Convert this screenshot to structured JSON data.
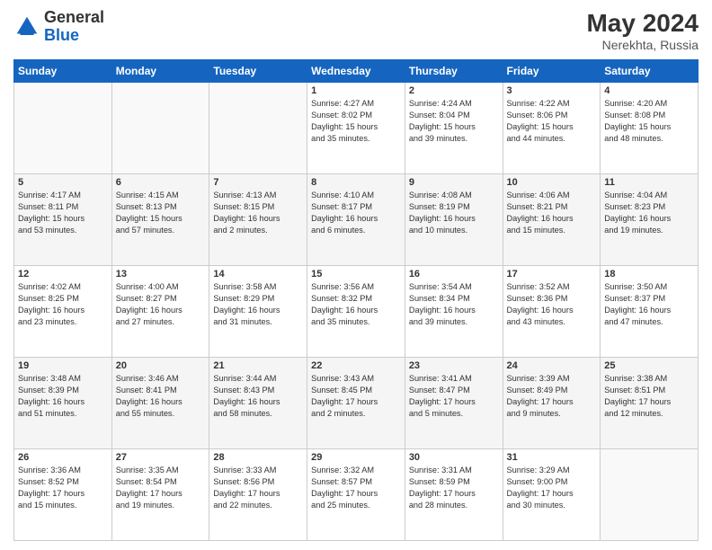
{
  "header": {
    "monthYear": "May 2024",
    "location": "Nerekhta, Russia"
  },
  "days": [
    "Sunday",
    "Monday",
    "Tuesday",
    "Wednesday",
    "Thursday",
    "Friday",
    "Saturday"
  ],
  "weeks": [
    [
      {
        "day": "",
        "info": ""
      },
      {
        "day": "",
        "info": ""
      },
      {
        "day": "",
        "info": ""
      },
      {
        "day": "1",
        "info": "Sunrise: 4:27 AM\nSunset: 8:02 PM\nDaylight: 15 hours\nand 35 minutes."
      },
      {
        "day": "2",
        "info": "Sunrise: 4:24 AM\nSunset: 8:04 PM\nDaylight: 15 hours\nand 39 minutes."
      },
      {
        "day": "3",
        "info": "Sunrise: 4:22 AM\nSunset: 8:06 PM\nDaylight: 15 hours\nand 44 minutes."
      },
      {
        "day": "4",
        "info": "Sunrise: 4:20 AM\nSunset: 8:08 PM\nDaylight: 15 hours\nand 48 minutes."
      }
    ],
    [
      {
        "day": "5",
        "info": "Sunrise: 4:17 AM\nSunset: 8:11 PM\nDaylight: 15 hours\nand 53 minutes."
      },
      {
        "day": "6",
        "info": "Sunrise: 4:15 AM\nSunset: 8:13 PM\nDaylight: 15 hours\nand 57 minutes."
      },
      {
        "day": "7",
        "info": "Sunrise: 4:13 AM\nSunset: 8:15 PM\nDaylight: 16 hours\nand 2 minutes."
      },
      {
        "day": "8",
        "info": "Sunrise: 4:10 AM\nSunset: 8:17 PM\nDaylight: 16 hours\nand 6 minutes."
      },
      {
        "day": "9",
        "info": "Sunrise: 4:08 AM\nSunset: 8:19 PM\nDaylight: 16 hours\nand 10 minutes."
      },
      {
        "day": "10",
        "info": "Sunrise: 4:06 AM\nSunset: 8:21 PM\nDaylight: 16 hours\nand 15 minutes."
      },
      {
        "day": "11",
        "info": "Sunrise: 4:04 AM\nSunset: 8:23 PM\nDaylight: 16 hours\nand 19 minutes."
      }
    ],
    [
      {
        "day": "12",
        "info": "Sunrise: 4:02 AM\nSunset: 8:25 PM\nDaylight: 16 hours\nand 23 minutes."
      },
      {
        "day": "13",
        "info": "Sunrise: 4:00 AM\nSunset: 8:27 PM\nDaylight: 16 hours\nand 27 minutes."
      },
      {
        "day": "14",
        "info": "Sunrise: 3:58 AM\nSunset: 8:29 PM\nDaylight: 16 hours\nand 31 minutes."
      },
      {
        "day": "15",
        "info": "Sunrise: 3:56 AM\nSunset: 8:32 PM\nDaylight: 16 hours\nand 35 minutes."
      },
      {
        "day": "16",
        "info": "Sunrise: 3:54 AM\nSunset: 8:34 PM\nDaylight: 16 hours\nand 39 minutes."
      },
      {
        "day": "17",
        "info": "Sunrise: 3:52 AM\nSunset: 8:36 PM\nDaylight: 16 hours\nand 43 minutes."
      },
      {
        "day": "18",
        "info": "Sunrise: 3:50 AM\nSunset: 8:37 PM\nDaylight: 16 hours\nand 47 minutes."
      }
    ],
    [
      {
        "day": "19",
        "info": "Sunrise: 3:48 AM\nSunset: 8:39 PM\nDaylight: 16 hours\nand 51 minutes."
      },
      {
        "day": "20",
        "info": "Sunrise: 3:46 AM\nSunset: 8:41 PM\nDaylight: 16 hours\nand 55 minutes."
      },
      {
        "day": "21",
        "info": "Sunrise: 3:44 AM\nSunset: 8:43 PM\nDaylight: 16 hours\nand 58 minutes."
      },
      {
        "day": "22",
        "info": "Sunrise: 3:43 AM\nSunset: 8:45 PM\nDaylight: 17 hours\nand 2 minutes."
      },
      {
        "day": "23",
        "info": "Sunrise: 3:41 AM\nSunset: 8:47 PM\nDaylight: 17 hours\nand 5 minutes."
      },
      {
        "day": "24",
        "info": "Sunrise: 3:39 AM\nSunset: 8:49 PM\nDaylight: 17 hours\nand 9 minutes."
      },
      {
        "day": "25",
        "info": "Sunrise: 3:38 AM\nSunset: 8:51 PM\nDaylight: 17 hours\nand 12 minutes."
      }
    ],
    [
      {
        "day": "26",
        "info": "Sunrise: 3:36 AM\nSunset: 8:52 PM\nDaylight: 17 hours\nand 15 minutes."
      },
      {
        "day": "27",
        "info": "Sunrise: 3:35 AM\nSunset: 8:54 PM\nDaylight: 17 hours\nand 19 minutes."
      },
      {
        "day": "28",
        "info": "Sunrise: 3:33 AM\nSunset: 8:56 PM\nDaylight: 17 hours\nand 22 minutes."
      },
      {
        "day": "29",
        "info": "Sunrise: 3:32 AM\nSunset: 8:57 PM\nDaylight: 17 hours\nand 25 minutes."
      },
      {
        "day": "30",
        "info": "Sunrise: 3:31 AM\nSunset: 8:59 PM\nDaylight: 17 hours\nand 28 minutes."
      },
      {
        "day": "31",
        "info": "Sunrise: 3:29 AM\nSunset: 9:00 PM\nDaylight: 17 hours\nand 30 minutes."
      },
      {
        "day": "",
        "info": ""
      }
    ]
  ]
}
